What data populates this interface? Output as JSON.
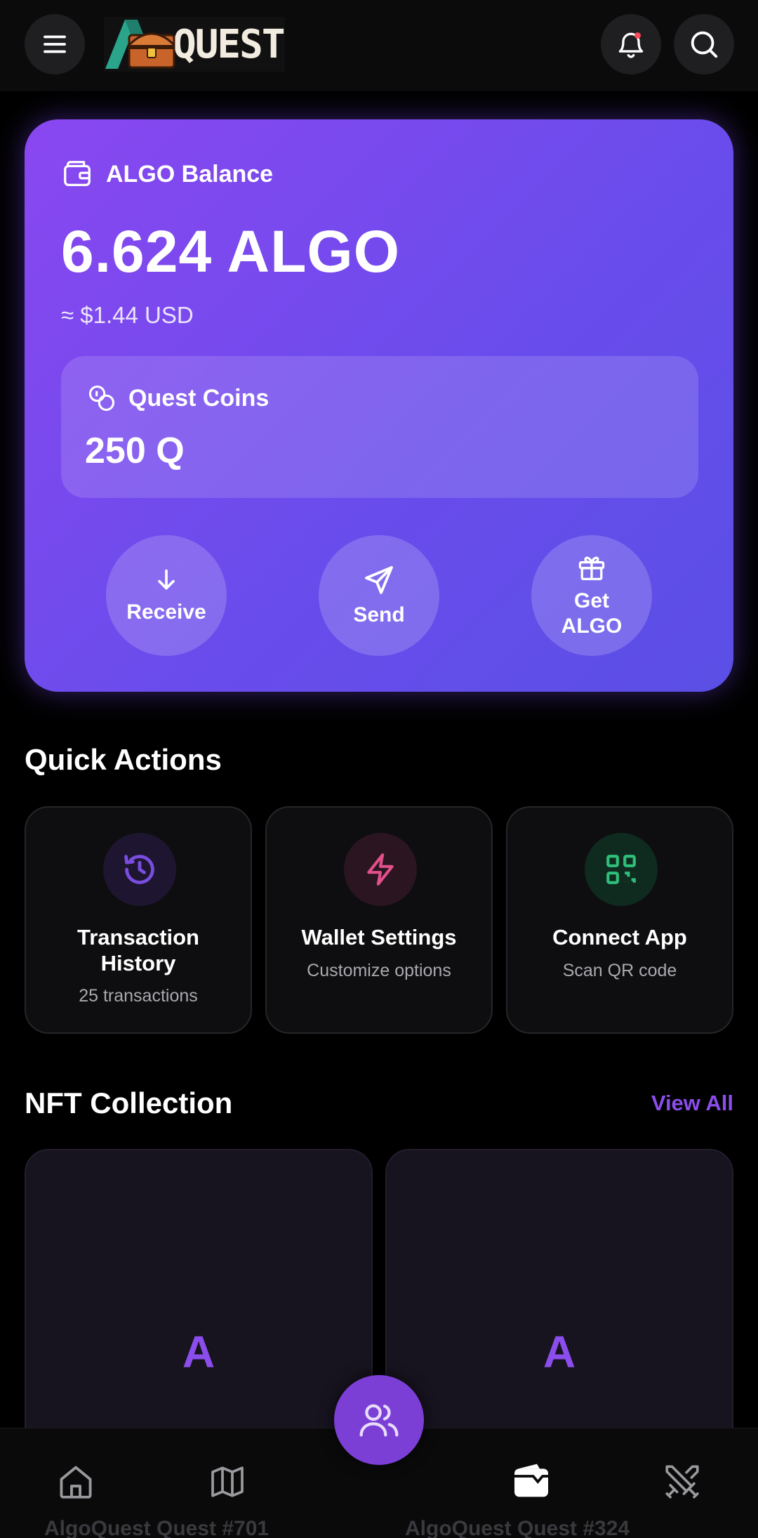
{
  "app": {
    "logo_text": "QUEST"
  },
  "balance": {
    "label": "ALGO Balance",
    "amount": "6.624 ALGO",
    "usd": "≈ $1.44 USD"
  },
  "quest_coins": {
    "label": "Quest Coins",
    "value": "250 Q"
  },
  "actions": [
    {
      "label": "Receive",
      "icon": "arrow-down-icon"
    },
    {
      "label": "Send",
      "icon": "send-icon"
    },
    {
      "label": "Get ALGO",
      "icon": "gift-icon"
    }
  ],
  "quick_actions": {
    "title": "Quick Actions",
    "items": [
      {
        "name": "Transaction History",
        "sub": "25 transactions",
        "icon": "history-icon",
        "color": "#7a4de0"
      },
      {
        "name": "Wallet Settings",
        "sub": "Customize options",
        "icon": "lightning-icon",
        "color": "#e0508a"
      },
      {
        "name": "Connect App",
        "sub": "Scan QR code",
        "icon": "qr-code-icon",
        "color": "#2fbf7a"
      }
    ]
  },
  "nft": {
    "title": "NFT Collection",
    "view_all": "View All",
    "items": [
      {
        "letter": "A",
        "name": "AlgoQuest Quest #701"
      },
      {
        "letter": "A",
        "name": "AlgoQuest Quest #324"
      }
    ]
  },
  "nav": [
    "home-icon",
    "map-icon",
    "friends-icon",
    "wallet-icon",
    "battle-icon"
  ],
  "colors": {
    "accent": "#8b4dec",
    "card_start": "#8a47f0",
    "card_end": "#5a4fe6"
  }
}
